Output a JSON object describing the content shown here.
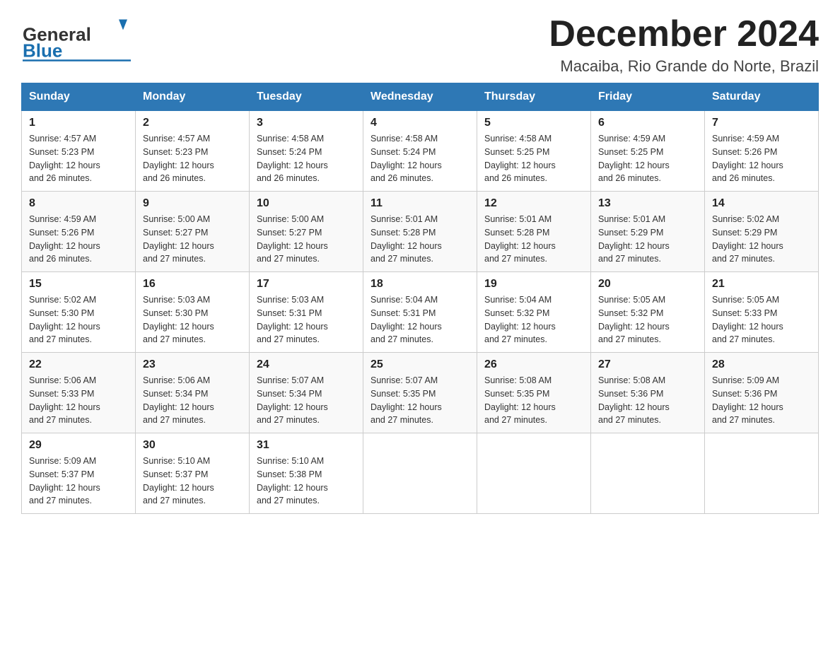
{
  "header": {
    "logo_general": "General",
    "logo_blue": "Blue",
    "month_title": "December 2024",
    "location": "Macaiba, Rio Grande do Norte, Brazil"
  },
  "days_of_week": [
    "Sunday",
    "Monday",
    "Tuesday",
    "Wednesday",
    "Thursday",
    "Friday",
    "Saturday"
  ],
  "weeks": [
    [
      {
        "day": "1",
        "sunrise": "4:57 AM",
        "sunset": "5:23 PM",
        "daylight": "12 hours and 26 minutes."
      },
      {
        "day": "2",
        "sunrise": "4:57 AM",
        "sunset": "5:23 PM",
        "daylight": "12 hours and 26 minutes."
      },
      {
        "day": "3",
        "sunrise": "4:58 AM",
        "sunset": "5:24 PM",
        "daylight": "12 hours and 26 minutes."
      },
      {
        "day": "4",
        "sunrise": "4:58 AM",
        "sunset": "5:24 PM",
        "daylight": "12 hours and 26 minutes."
      },
      {
        "day": "5",
        "sunrise": "4:58 AM",
        "sunset": "5:25 PM",
        "daylight": "12 hours and 26 minutes."
      },
      {
        "day": "6",
        "sunrise": "4:59 AM",
        "sunset": "5:25 PM",
        "daylight": "12 hours and 26 minutes."
      },
      {
        "day": "7",
        "sunrise": "4:59 AM",
        "sunset": "5:26 PM",
        "daylight": "12 hours and 26 minutes."
      }
    ],
    [
      {
        "day": "8",
        "sunrise": "4:59 AM",
        "sunset": "5:26 PM",
        "daylight": "12 hours and 26 minutes."
      },
      {
        "day": "9",
        "sunrise": "5:00 AM",
        "sunset": "5:27 PM",
        "daylight": "12 hours and 27 minutes."
      },
      {
        "day": "10",
        "sunrise": "5:00 AM",
        "sunset": "5:27 PM",
        "daylight": "12 hours and 27 minutes."
      },
      {
        "day": "11",
        "sunrise": "5:01 AM",
        "sunset": "5:28 PM",
        "daylight": "12 hours and 27 minutes."
      },
      {
        "day": "12",
        "sunrise": "5:01 AM",
        "sunset": "5:28 PM",
        "daylight": "12 hours and 27 minutes."
      },
      {
        "day": "13",
        "sunrise": "5:01 AM",
        "sunset": "5:29 PM",
        "daylight": "12 hours and 27 minutes."
      },
      {
        "day": "14",
        "sunrise": "5:02 AM",
        "sunset": "5:29 PM",
        "daylight": "12 hours and 27 minutes."
      }
    ],
    [
      {
        "day": "15",
        "sunrise": "5:02 AM",
        "sunset": "5:30 PM",
        "daylight": "12 hours and 27 minutes."
      },
      {
        "day": "16",
        "sunrise": "5:03 AM",
        "sunset": "5:30 PM",
        "daylight": "12 hours and 27 minutes."
      },
      {
        "day": "17",
        "sunrise": "5:03 AM",
        "sunset": "5:31 PM",
        "daylight": "12 hours and 27 minutes."
      },
      {
        "day": "18",
        "sunrise": "5:04 AM",
        "sunset": "5:31 PM",
        "daylight": "12 hours and 27 minutes."
      },
      {
        "day": "19",
        "sunrise": "5:04 AM",
        "sunset": "5:32 PM",
        "daylight": "12 hours and 27 minutes."
      },
      {
        "day": "20",
        "sunrise": "5:05 AM",
        "sunset": "5:32 PM",
        "daylight": "12 hours and 27 minutes."
      },
      {
        "day": "21",
        "sunrise": "5:05 AM",
        "sunset": "5:33 PM",
        "daylight": "12 hours and 27 minutes."
      }
    ],
    [
      {
        "day": "22",
        "sunrise": "5:06 AM",
        "sunset": "5:33 PM",
        "daylight": "12 hours and 27 minutes."
      },
      {
        "day": "23",
        "sunrise": "5:06 AM",
        "sunset": "5:34 PM",
        "daylight": "12 hours and 27 minutes."
      },
      {
        "day": "24",
        "sunrise": "5:07 AM",
        "sunset": "5:34 PM",
        "daylight": "12 hours and 27 minutes."
      },
      {
        "day": "25",
        "sunrise": "5:07 AM",
        "sunset": "5:35 PM",
        "daylight": "12 hours and 27 minutes."
      },
      {
        "day": "26",
        "sunrise": "5:08 AM",
        "sunset": "5:35 PM",
        "daylight": "12 hours and 27 minutes."
      },
      {
        "day": "27",
        "sunrise": "5:08 AM",
        "sunset": "5:36 PM",
        "daylight": "12 hours and 27 minutes."
      },
      {
        "day": "28",
        "sunrise": "5:09 AM",
        "sunset": "5:36 PM",
        "daylight": "12 hours and 27 minutes."
      }
    ],
    [
      {
        "day": "29",
        "sunrise": "5:09 AM",
        "sunset": "5:37 PM",
        "daylight": "12 hours and 27 minutes."
      },
      {
        "day": "30",
        "sunrise": "5:10 AM",
        "sunset": "5:37 PM",
        "daylight": "12 hours and 27 minutes."
      },
      {
        "day": "31",
        "sunrise": "5:10 AM",
        "sunset": "5:38 PM",
        "daylight": "12 hours and 27 minutes."
      },
      null,
      null,
      null,
      null
    ]
  ],
  "labels": {
    "sunrise": "Sunrise:",
    "sunset": "Sunset:",
    "daylight": "Daylight:"
  }
}
